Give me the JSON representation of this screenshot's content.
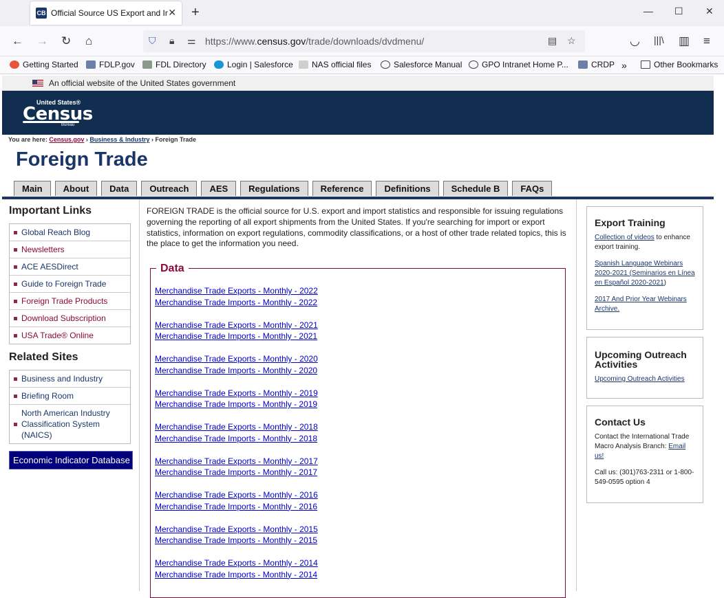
{
  "browser": {
    "tab_title": "Official Source US Export and Im",
    "favicon_text": "CB",
    "url_prefix": "https://www.",
    "url_domain": "census.gov",
    "url_path": "/trade/downloads/dvdmenu/",
    "bookmarks": [
      "Getting Started",
      "FDLP.gov",
      "FDL Directory",
      "Login | Salesforce",
      "NAS official files",
      "Salesforce Manual",
      "GPO Intranet Home P...",
      "CRDP",
      "Other Bookmarks"
    ]
  },
  "gov_banner": "An official website of the United States government",
  "logo": {
    "line1": "United States®",
    "line2": "Census",
    "line3": "Bureau"
  },
  "breadcrumb": {
    "prefix": "You are here:",
    "crumb1": "Census.gov",
    "sep": "›",
    "crumb2": "Business & Industry",
    "current": "Foreign Trade"
  },
  "page_title": "Foreign Trade",
  "nav_tabs": [
    "Main",
    "About",
    "Data",
    "Outreach",
    "AES",
    "Regulations",
    "Reference",
    "Definitions",
    "Schedule B",
    "FAQs"
  ],
  "left": {
    "important_heading": "Important Links",
    "important_links": [
      "Global Reach Blog",
      "Newsletters",
      "ACE AESDirect",
      "Guide to Foreign Trade",
      "Foreign Trade Products",
      "Download Subscription",
      "USA Trade® Online"
    ],
    "related_heading": "Related Sites",
    "related_links": [
      "Business and Industry",
      "Briefing Room",
      "North American Industry Classification System (NAICS)"
    ],
    "eid_button": "Economic Indicator Database"
  },
  "intro": "FOREIGN TRADE is the official source for U.S. export and import statistics and responsible for issuing regulations governing the reporting of all export shipments from the United States. If you're searching for import or export statistics, information on export regulations, commodity classifications, or a host of other trade related topics, this is the place to get the information you need.",
  "data": {
    "legend": "Data",
    "groups": [
      [
        "Merchandise Trade Exports - Monthly - 2022",
        "Merchandise Trade Imports - Monthly - 2022"
      ],
      [
        "Merchandise Trade Exports - Monthly - 2021",
        "Merchandise Trade Imports - Monthly - 2021"
      ],
      [
        "Merchandise Trade Exports - Monthly - 2020",
        "Merchandise Trade Imports - Monthly - 2020"
      ],
      [
        "Merchandise Trade Exports - Monthly - 2019",
        "Merchandise Trade Imports - Monthly - 2019"
      ],
      [
        "Merchandise Trade Exports - Monthly - 2018",
        "Merchandise Trade Imports - Monthly - 2018"
      ],
      [
        "Merchandise Trade Exports - Monthly - 2017",
        "Merchandise Trade Imports - Monthly - 2017"
      ],
      [
        "Merchandise Trade Exports - Monthly - 2016",
        "Merchandise Trade Imports - Monthly - 2016"
      ],
      [
        "Merchandise Trade Exports - Monthly - 2015",
        "Merchandise Trade Imports - Monthly - 2015"
      ],
      [
        "Merchandise Trade Exports - Monthly - 2014",
        "Merchandise Trade Imports - Monthly - 2014"
      ]
    ]
  },
  "right": {
    "export_training": {
      "heading": "Export Training",
      "videos_link": "Collection of videos",
      "videos_text": " to enhance export training.",
      "spanish_link": "Spanish Language Webinars 2020-2021 (Seminarios en Línea en Español 2020-2021",
      "spanish_close": ")",
      "archive_link": "2017 And Prior Year Webinars Archive."
    },
    "outreach": {
      "heading": "Upcoming Outreach Activities",
      "link": "Upcoming Outreach Activities"
    },
    "contact": {
      "heading": "Contact Us",
      "text": "Contact the International Trade Macro Analysis Branch: ",
      "email_link": "Email us!",
      "call": "Call us: (301)763-2311 or 1-800-549-0595 option 4"
    }
  },
  "colors": {
    "header_navy": "#112e51",
    "title_blue": "#1a3668",
    "accent_maroon": "#8b0a3b",
    "link_blue": "#0000cc",
    "eid_navy": "#00007c"
  }
}
